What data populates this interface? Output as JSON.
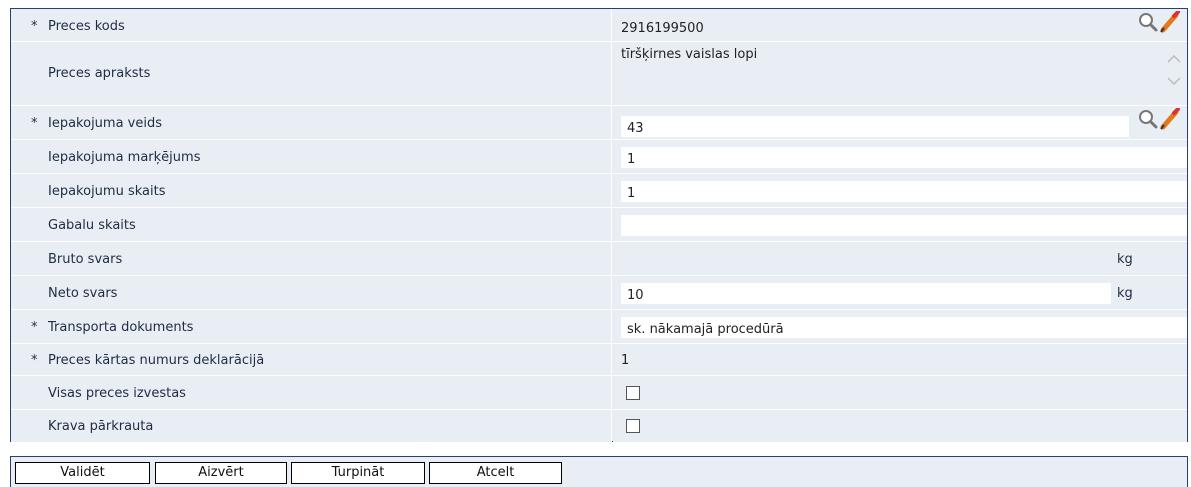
{
  "rows": [
    {
      "required": "*",
      "label": "Preces kods",
      "value": "2916199500"
    },
    {
      "required": "",
      "label": "Preces apraksts",
      "value": "tīršķirnes vaislas lopi"
    },
    {
      "required": "*",
      "label": "Iepakojuma veids",
      "value": "43"
    },
    {
      "required": "",
      "label": "Iepakojuma marķējums",
      "value": "1"
    },
    {
      "required": "",
      "label": "Iepakojumu skaits",
      "value": "1"
    },
    {
      "required": "",
      "label": "Gabalu skaits",
      "value": ""
    },
    {
      "required": "",
      "label": "Bruto svars",
      "value": "",
      "unit": "kg"
    },
    {
      "required": "",
      "label": "Neto svars",
      "value": "10",
      "unit": "kg"
    },
    {
      "required": "*",
      "label": "Transporta dokuments",
      "value": "sk. nākamajā procedūrā"
    },
    {
      "required": "*",
      "label": "Preces kārtas numurs deklarācijā",
      "value": "1"
    },
    {
      "required": "",
      "label": "Visas preces izvestas",
      "checked": false
    },
    {
      "required": "",
      "label": "Krava pārkrauta",
      "checked": false
    }
  ],
  "buttons": {
    "validate": "Validēt",
    "close": "Aizvērt",
    "continue": "Turpināt",
    "cancel": "Atcelt"
  },
  "icons": {
    "lookup": "magnifier-icon",
    "edit": "pencil-icon"
  }
}
